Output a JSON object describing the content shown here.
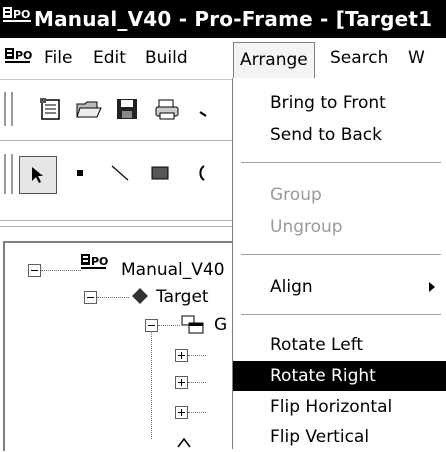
{
  "window": {
    "title": "Manual_V40 - Pro-Frame - [Target1"
  },
  "menubar": {
    "items": [
      {
        "label": "File"
      },
      {
        "label": "Edit"
      },
      {
        "label": "Build"
      },
      {
        "label": "Arrange"
      },
      {
        "label": "Search"
      },
      {
        "label": "W"
      }
    ]
  },
  "arrange_menu": {
    "bring_to_front": "Bring to Front",
    "send_to_back": "Send to Back",
    "group": "Group",
    "ungroup": "Ungroup",
    "align": "Align",
    "rotate_left": "Rotate Left",
    "rotate_right": "Rotate Right",
    "flip_horizontal": "Flip Horizontal",
    "flip_vertical": "Flip Vertical"
  },
  "tree": {
    "root": "Manual_V40",
    "target": "Target",
    "group_partial": "G"
  },
  "icons": {
    "app": "pro-frame-app-icon",
    "new": "new-doc-icon",
    "open": "open-folder-icon",
    "save": "save-disk-icon",
    "print": "print-icon",
    "pointer": "select-arrow-icon",
    "point": "point-tool-icon",
    "line": "line-tool-icon",
    "rect": "rectangle-tool-icon",
    "ellipse": "ellipse-tool-icon"
  },
  "colors": {
    "highlight": "#000000",
    "disabled_text": "#9a9a9a"
  }
}
